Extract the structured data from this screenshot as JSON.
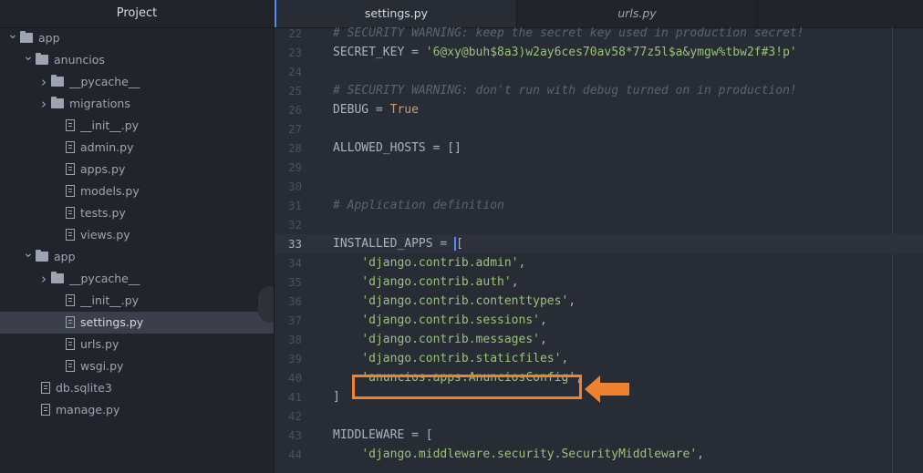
{
  "sidebar": {
    "title": "Project",
    "items": [
      {
        "label": "app",
        "type": "folder",
        "depth": 0,
        "expanded": true
      },
      {
        "label": "anuncios",
        "type": "folder",
        "depth": 1,
        "expanded": true
      },
      {
        "label": "__pycache__",
        "type": "folder",
        "depth": 2,
        "expanded": false
      },
      {
        "label": "migrations",
        "type": "folder",
        "depth": 2,
        "expanded": false
      },
      {
        "label": "__init__.py",
        "type": "file",
        "depth": 2
      },
      {
        "label": "admin.py",
        "type": "file",
        "depth": 2
      },
      {
        "label": "apps.py",
        "type": "file",
        "depth": 2
      },
      {
        "label": "models.py",
        "type": "file",
        "depth": 2
      },
      {
        "label": "tests.py",
        "type": "file",
        "depth": 2
      },
      {
        "label": "views.py",
        "type": "file",
        "depth": 2
      },
      {
        "label": "app",
        "type": "folder",
        "depth": 1,
        "expanded": true
      },
      {
        "label": "__pycache__",
        "type": "folder",
        "depth": 2,
        "expanded": false
      },
      {
        "label": "__init__.py",
        "type": "file",
        "depth": 2
      },
      {
        "label": "settings.py",
        "type": "file",
        "depth": 2,
        "selected": true
      },
      {
        "label": "urls.py",
        "type": "file",
        "depth": 2
      },
      {
        "label": "wsgi.py",
        "type": "file",
        "depth": 2
      },
      {
        "label": "db.sqlite3",
        "type": "file",
        "depth": 1
      },
      {
        "label": "manage.py",
        "type": "file",
        "depth": 1
      }
    ]
  },
  "tabs": [
    {
      "label": "settings.py",
      "active": true
    },
    {
      "label": "urls.py",
      "active": false
    }
  ],
  "editor": {
    "current_line": 33,
    "lines": [
      {
        "num": "22",
        "text": "# SECURITY WARNING: keep the secret key used in production secret!"
      },
      {
        "num": "23",
        "text": "SECRET_KEY = '6@xy@buh$8a3)w2ay6ces70av58*77z5l$a&ymgw%tbw2f#3!p'"
      },
      {
        "num": "24",
        "text": ""
      },
      {
        "num": "25",
        "text": "# SECURITY WARNING: don't run with debug turned on in production!"
      },
      {
        "num": "26",
        "text": "DEBUG = True"
      },
      {
        "num": "27",
        "text": ""
      },
      {
        "num": "28",
        "text": "ALLOWED_HOSTS = []"
      },
      {
        "num": "29",
        "text": ""
      },
      {
        "num": "30",
        "text": ""
      },
      {
        "num": "31",
        "text": "# Application definition"
      },
      {
        "num": "32",
        "text": ""
      },
      {
        "num": "33",
        "text": "INSTALLED_APPS = ["
      },
      {
        "num": "34",
        "text": "    'django.contrib.admin',"
      },
      {
        "num": "35",
        "text": "    'django.contrib.auth',"
      },
      {
        "num": "36",
        "text": "    'django.contrib.contenttypes',"
      },
      {
        "num": "37",
        "text": "    'django.contrib.sessions',"
      },
      {
        "num": "38",
        "text": "    'django.contrib.messages',"
      },
      {
        "num": "39",
        "text": "    'django.contrib.staticfiles',"
      },
      {
        "num": "40",
        "text": "    'anuncios.apps.AnunciosConfig',"
      },
      {
        "num": "41",
        "text": "]"
      },
      {
        "num": "42",
        "text": ""
      },
      {
        "num": "43",
        "text": "MIDDLEWARE = ["
      },
      {
        "num": "44",
        "text": "    'django.middleware.security.SecurityMiddleware',"
      }
    ]
  },
  "annotation": {
    "color": "#f0822e",
    "highlighted_line": 40
  },
  "colors": {
    "comment": "#5c6370",
    "string": "#98c379",
    "constant": "#d19a66",
    "cursor": "#528bff"
  }
}
